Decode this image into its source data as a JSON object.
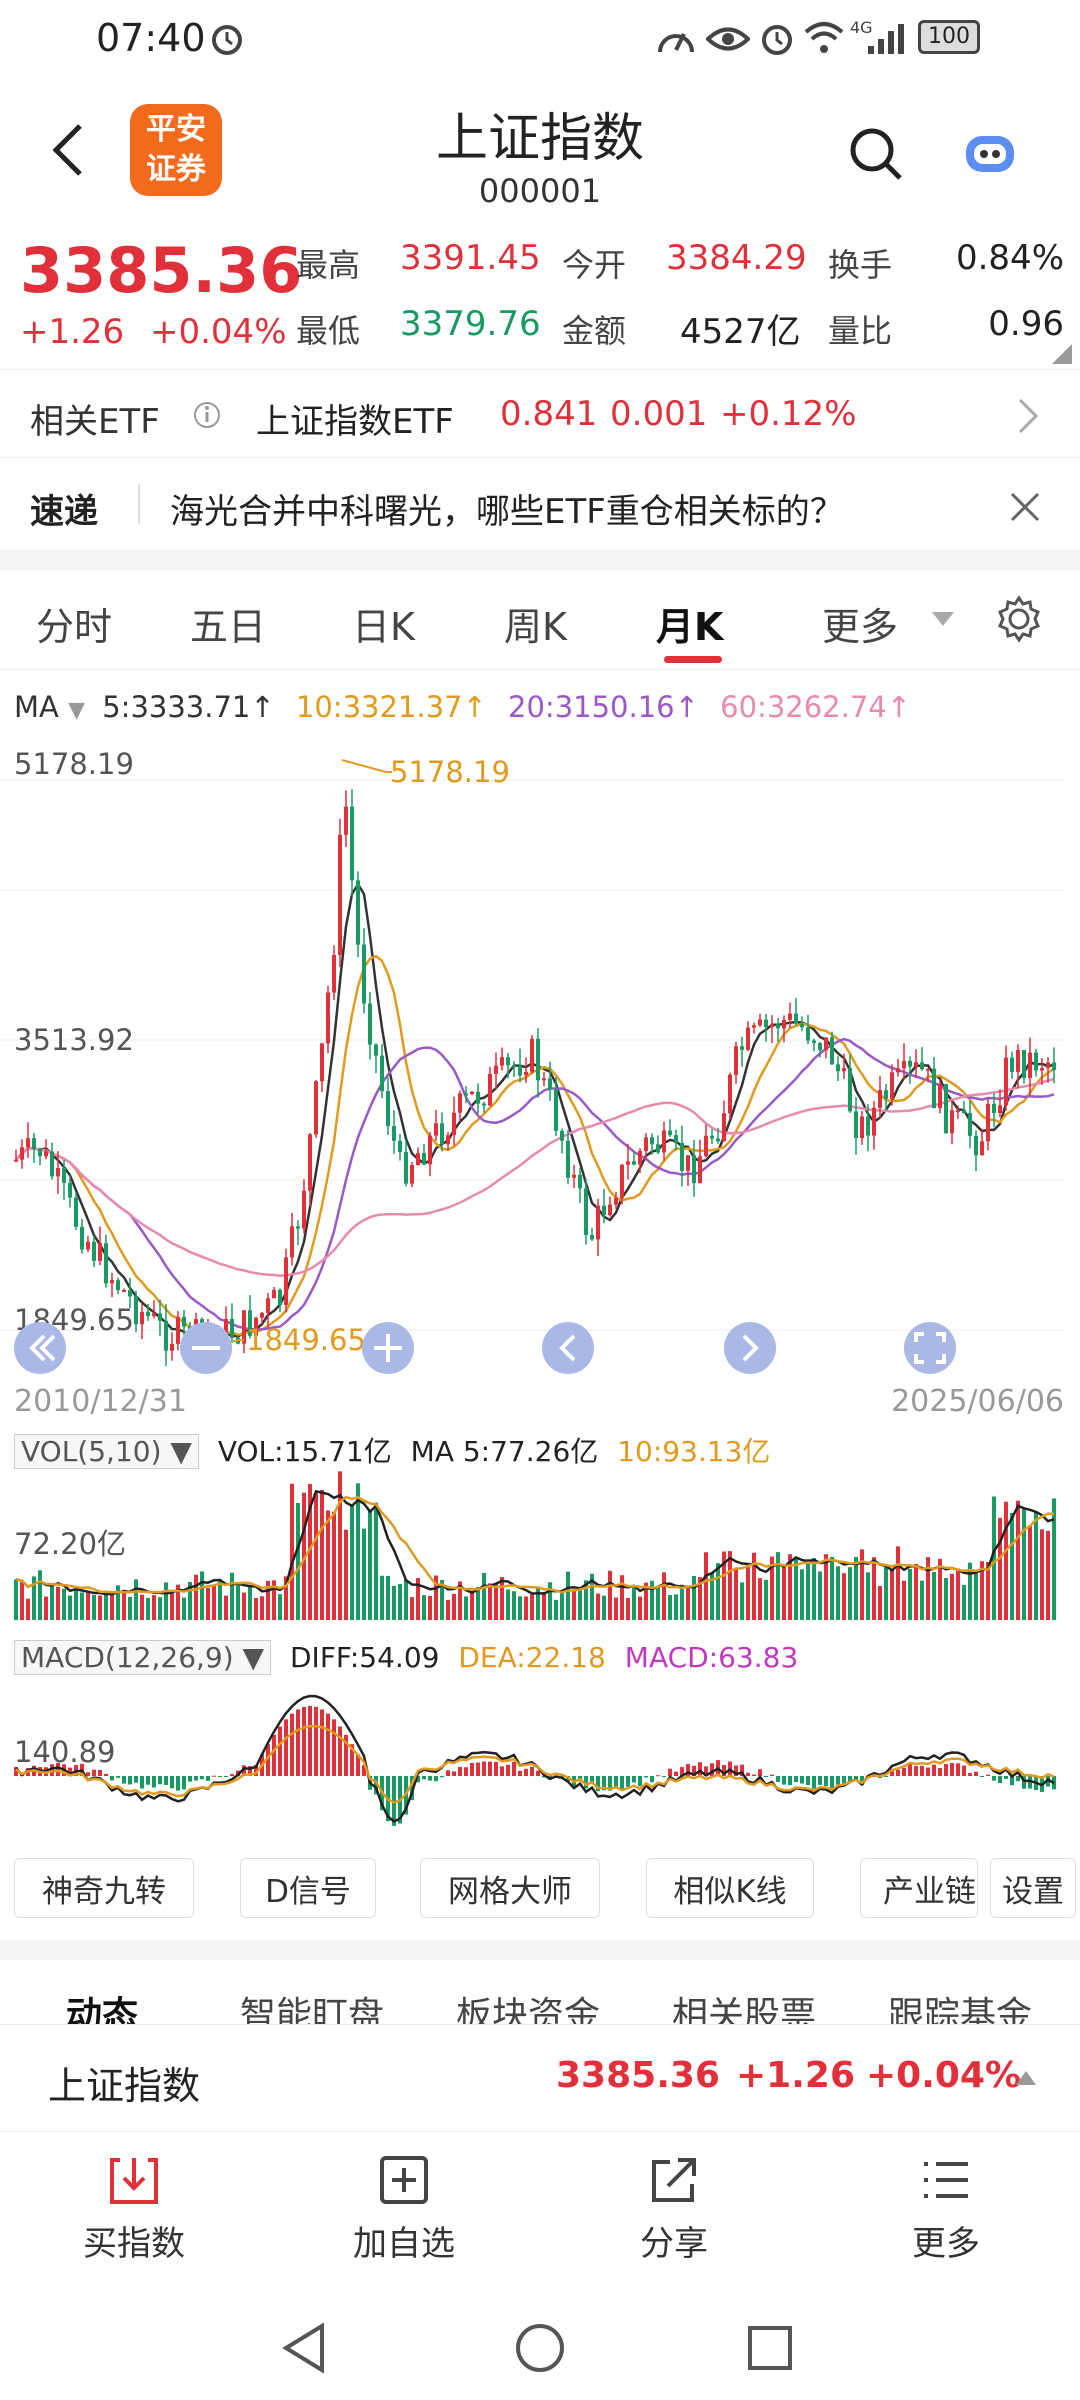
{
  "status_bar": {
    "time": "07:40",
    "network": "4G",
    "battery": "100"
  },
  "header": {
    "logo_line1": "平安",
    "logo_line2": "证券",
    "title": "上证指数",
    "code": "000001"
  },
  "quote": {
    "price": "3385.36",
    "change": "+1.26",
    "change_pct": "+0.04%",
    "high_label": "最高",
    "high": "3391.45",
    "open_label": "今开",
    "open": "3384.29",
    "turnover_label": "换手",
    "turnover": "0.84%",
    "low_label": "最低",
    "low": "3379.76",
    "amount_label": "金额",
    "amount": "4527亿",
    "volratio_label": "量比",
    "volratio": "0.96"
  },
  "etf": {
    "label": "相关ETF",
    "name": "上证指数ETF",
    "price": "0.841",
    "change": "0.001",
    "pct": "+0.12%"
  },
  "news": {
    "label": "速递",
    "text": "海光合并中科曙光，哪些ETF重仓相关标的？"
  },
  "tabs": [
    "分时",
    "五日",
    "日K",
    "周K",
    "月K",
    "更多"
  ],
  "active_tab": "月K",
  "ma": {
    "label": "MA",
    "ma5": "5:3333.71↑",
    "ma10": "10:3321.37↑",
    "ma20": "20:3150.16↑",
    "ma60": "60:3262.74↑",
    "colors": {
      "ma5": "#333333",
      "ma10": "#e09a20",
      "ma20": "#9b59c7",
      "ma60": "#e88ab0"
    }
  },
  "axis": {
    "top": "5178.19",
    "mid": "3513.92",
    "bottom": "1849.65",
    "max_marker": "5178.19",
    "min_marker": "1849.65",
    "date_start": "2010/12/31",
    "date_end": "2025/06/06"
  },
  "vol": {
    "box": "VOL(5,10)",
    "vol": "VOL:15.71亿",
    "ma5": "MA 5:77.26亿",
    "ma10": "10:93.13亿",
    "axis": "72.20亿"
  },
  "macd": {
    "box": "MACD(12,26,9)",
    "diff": "DIFF:54.09",
    "dea": "DEA:22.18",
    "macd": "MACD:63.83",
    "axis": "140.89"
  },
  "tools": [
    "神奇九转",
    "D信号",
    "网格大师",
    "相似K线",
    "产业链",
    "设置"
  ],
  "subtabs": [
    "动态",
    "智能盯盘",
    "板块资金",
    "相关股票",
    "跟踪基金"
  ],
  "ticker": {
    "name": "上证指数",
    "price": "3385.36",
    "change": "+1.26",
    "pct": "+0.04%"
  },
  "actions": [
    "买指数",
    "加自选",
    "分享",
    "更多"
  ],
  "colors": {
    "up": "#e0303a",
    "down": "#1a9a63",
    "accent": "#f26b1d"
  }
}
